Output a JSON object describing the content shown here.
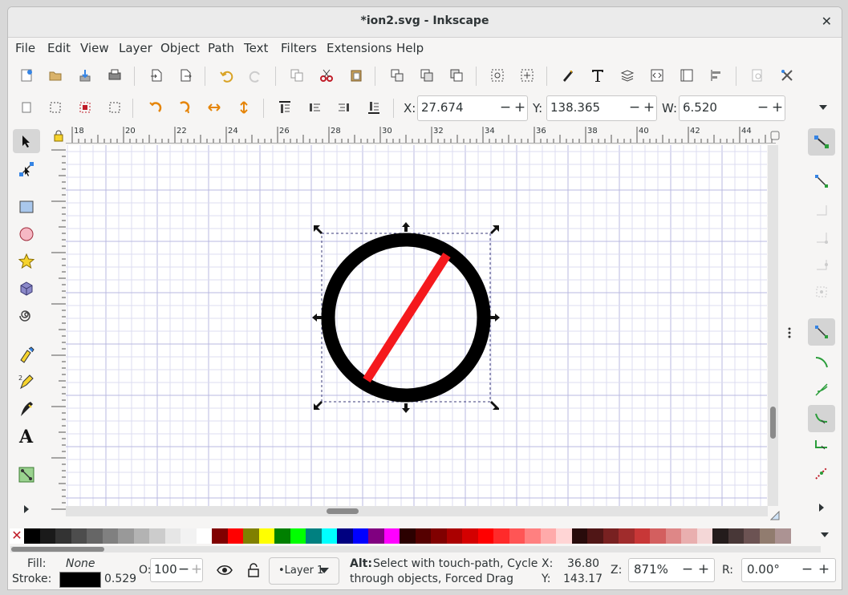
{
  "window": {
    "title": "*ion2.svg - Inkscape",
    "close_glyph": "✕"
  },
  "menu": [
    "File",
    "Edit",
    "View",
    "Layer",
    "Object",
    "Path",
    "Text",
    "Filters",
    "Extensions",
    "Help"
  ],
  "toolcontrols": {
    "x_label": "X:",
    "x_value": "27.674",
    "y_label": "Y:",
    "y_value": "138.365",
    "w_label": "W:",
    "w_value": "6.520",
    "minus": "−",
    "plus": "+"
  },
  "ruler": {
    "h_ticks": [
      "18",
      "20",
      "22",
      "24",
      "26",
      "28",
      "30",
      "32",
      "34",
      "36",
      "38",
      "40",
      "42",
      "44"
    ]
  },
  "palette": {
    "none_glyph": "✕",
    "colors": [
      "#000000",
      "#1a1a1a",
      "#333333",
      "#4d4d4d",
      "#666666",
      "#808080",
      "#999999",
      "#b3b3b3",
      "#cccccc",
      "#e6e6e6",
      "#f2f2f2",
      "#ffffff",
      "#800000",
      "#ff0000",
      "#808000",
      "#ffff00",
      "#008000",
      "#00ff00",
      "#008080",
      "#00ffff",
      "#000080",
      "#0000ff",
      "#800080",
      "#ff00ff",
      "#2b0000",
      "#550000",
      "#800000",
      "#aa0000",
      "#d40000",
      "#ff0000",
      "#ff2a2a",
      "#ff5555",
      "#ff8080",
      "#ffaaaa",
      "#ffd5d5",
      "#280b0b",
      "#501616",
      "#782121",
      "#a02c2c",
      "#c83737",
      "#d35f5f",
      "#de8787",
      "#e9afaf",
      "#f4d7d7",
      "#241c1c",
      "#483737",
      "#6c5353",
      "#917c6f",
      "#ac9393"
    ]
  },
  "status": {
    "fill_label": "Fill:",
    "fill_value": "None",
    "stroke_label": "Stroke:",
    "stroke_width": "0.529",
    "opacity_label": "O:",
    "opacity_value": "100",
    "layer_value": "•Layer 1",
    "message_bold": "Alt:",
    "message_line1": "Select with touch-path, Cycle",
    "message_line2": "through objects, Forced Drag",
    "cursor_x_label": "X:",
    "cursor_x": "36.80",
    "cursor_y_label": "Y:",
    "cursor_y": "143.17",
    "zoom_label": "Z:",
    "zoom_value": "871%",
    "rotate_label": "R:",
    "rotate_value": "0.00°"
  },
  "colors": {
    "stroke_color": "#000000",
    "circle_stroke": "#000000",
    "line_stroke": "#f5191d",
    "accent": "#3584e4"
  }
}
